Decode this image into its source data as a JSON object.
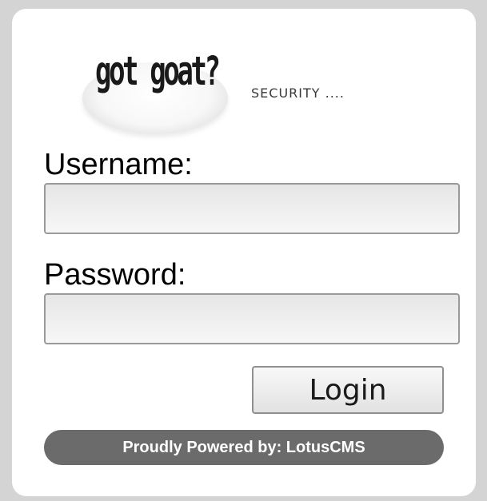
{
  "logo": {
    "text": "got goat?",
    "tagline": "SECURITY ...."
  },
  "form": {
    "username_label": "Username:",
    "username_value": "",
    "password_label": "Password:",
    "password_value": "",
    "login_label": "Login"
  },
  "footer": {
    "powered_text": "Proudly Powered by: LotusCMS"
  },
  "colors": {
    "page_background": "#d4d4d4",
    "panel_background": "#ffffff",
    "footer_bar": "#6b6b6b"
  }
}
